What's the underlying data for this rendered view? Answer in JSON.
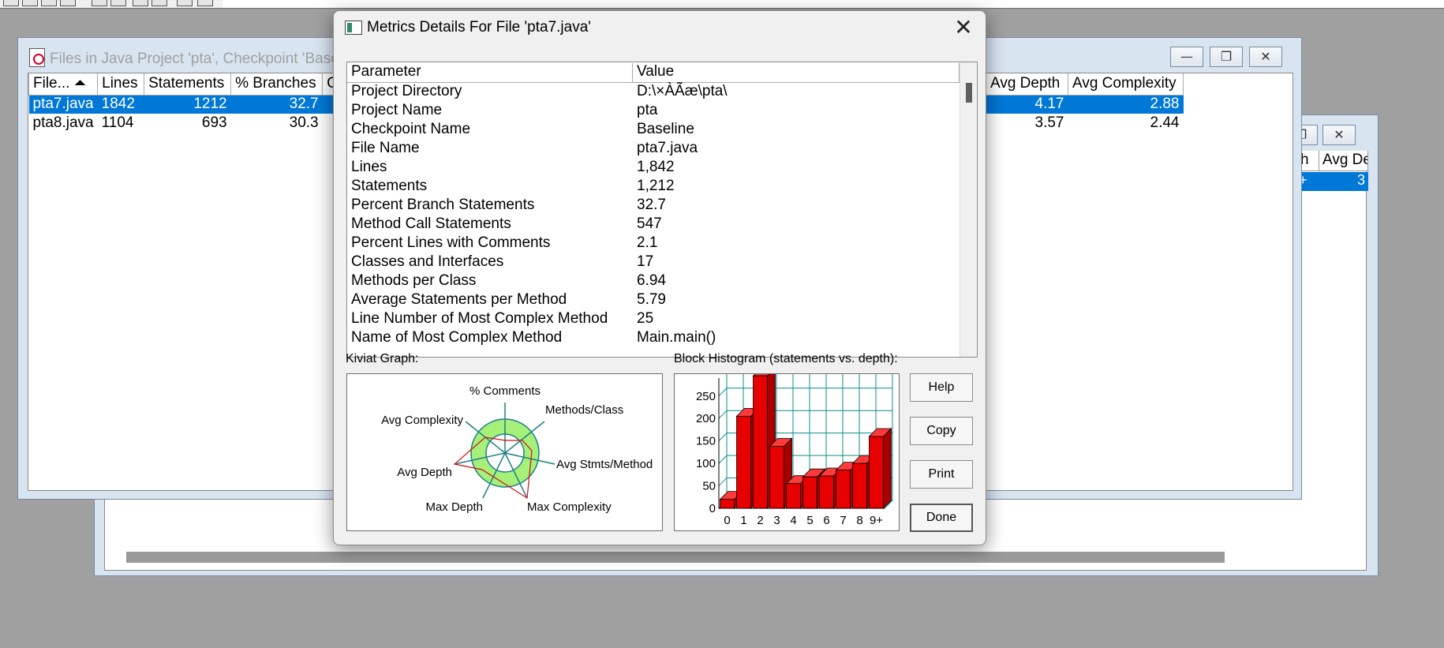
{
  "back_window": {
    "headers": [
      "h",
      "Avg De"
    ],
    "selected_row": [
      "+",
      "3"
    ]
  },
  "files_window": {
    "title": "Files in Java Project 'pta', Checkpoint 'Base",
    "columns": [
      "File... ⏶",
      "Lines",
      "Statements",
      "% Branches",
      "C",
      "Avg Depth",
      "Avg Complexity"
    ],
    "rows": [
      {
        "file": "pta7.java",
        "lines": "1842",
        "statements": "1212",
        "branches": "32.7",
        "avg_depth": "4.17",
        "avg_complexity": "2.88",
        "selected": true
      },
      {
        "file": "pta8.java",
        "lines": "1104",
        "statements": "693",
        "branches": "30.3",
        "avg_depth": "3.57",
        "avg_complexity": "2.44",
        "selected": false
      }
    ]
  },
  "dialog": {
    "title": "Metrics Details For File 'pta7.java'",
    "close_glyph": "✕",
    "table_headers": {
      "parameter": "Parameter",
      "value": "Value"
    },
    "params": [
      [
        "Project Directory",
        "D:\\×ÀÃæ\\pta\\"
      ],
      [
        "Project Name",
        "pta"
      ],
      [
        "Checkpoint Name",
        "Baseline"
      ],
      [
        "File Name",
        "pta7.java"
      ],
      [
        "Lines",
        "1,842"
      ],
      [
        "Statements",
        "1,212"
      ],
      [
        "Percent Branch Statements",
        "32.7"
      ],
      [
        "Method Call Statements",
        "547"
      ],
      [
        "Percent Lines with Comments",
        "2.1"
      ],
      [
        "Classes and Interfaces",
        "17"
      ],
      [
        "Methods per Class",
        "6.94"
      ],
      [
        "Average Statements per Method",
        "5.79"
      ],
      [
        "Line Number of Most Complex Method",
        "25"
      ],
      [
        "Name of Most Complex Method",
        "Main.main()"
      ]
    ],
    "kiviat_label": "Kiviat Graph:",
    "histogram_label": "Block Histogram (statements vs. depth):",
    "buttons": {
      "help": "Help",
      "copy": "Copy",
      "print": "Print",
      "done": "Done"
    }
  },
  "kiviat": {
    "axes": [
      "% Comments",
      "Methods/Class",
      "Avg Stmts/Method",
      "Max Complexity",
      "Max Depth",
      "Avg Depth",
      "Avg Complexity"
    ],
    "colors": {
      "band": "#a6f07a",
      "axis": "#1e7f86",
      "outline": "#d01010"
    }
  },
  "chart_data": {
    "type": "bar",
    "title": "Block Histogram (statements vs. depth):",
    "categories": [
      "0",
      "1",
      "2",
      "3",
      "4",
      "5",
      "6",
      "7",
      "8",
      "9+"
    ],
    "values": [
      20,
      205,
      295,
      138,
      55,
      70,
      72,
      85,
      100,
      160
    ],
    "y_ticks": [
      "0",
      "50",
      "100",
      "150",
      "200",
      "250"
    ],
    "ylim": [
      0,
      290
    ],
    "bar_color": "#e60000",
    "grid_color": "#0e8c8c"
  }
}
